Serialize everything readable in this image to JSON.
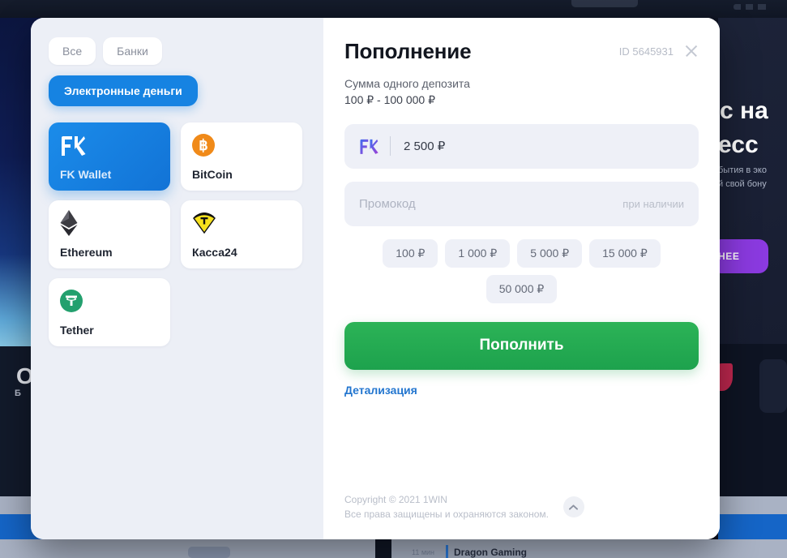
{
  "background": {
    "left_headline": "О",
    "left_subline": "Б",
    "right_headline_line1": "с на",
    "right_headline_line2": "есс",
    "right_sub_line1": "бытия в эко",
    "right_sub_line2": "й свой бону",
    "right_button_label": "НЕЕ",
    "bottom_time": "11 мин",
    "bottom_provider": "Dragon Gaming"
  },
  "left_panel": {
    "filters": [
      {
        "label": "Все",
        "active": false
      },
      {
        "label": "Банки",
        "active": false
      },
      {
        "label": "Электронные деньги",
        "active": true
      }
    ],
    "methods": [
      {
        "label": "FK Wallet",
        "icon": "fk-wallet-icon",
        "selected": true
      },
      {
        "label": "BitCoin",
        "icon": "bitcoin-icon",
        "selected": false
      },
      {
        "label": "Ethereum",
        "icon": "ethereum-icon",
        "selected": false
      },
      {
        "label": "Касса24",
        "icon": "kassa24-icon",
        "selected": false
      },
      {
        "label": "Tether",
        "icon": "tether-icon",
        "selected": false
      }
    ]
  },
  "right_panel": {
    "title": "Пополнение",
    "id_label": "ID 5645931",
    "close_icon": "close-icon",
    "subtitle_line1": "Сумма одного депозита",
    "subtitle_line2": "100 ₽ - 100 000 ₽",
    "amount_field": {
      "icon": "fk-wallet-icon",
      "value": "2 500 ₽"
    },
    "promo_field": {
      "placeholder": "Промокод",
      "hint": "при наличии",
      "value": ""
    },
    "quick_amounts": [
      "100 ₽",
      "1 000 ₽",
      "5 000 ₽",
      "15 000 ₽",
      "50 000 ₽"
    ],
    "submit_label": "Пополнить",
    "detail_link_label": "Детализация",
    "footer": {
      "line1": "Copyright © 2021 1WIN",
      "line2": "Все права защищены и охраняются законом.",
      "scroll_top_icon": "chevron-up-icon"
    }
  },
  "colors": {
    "accent_blue": "#1683e2",
    "accent_green": "#1da24d",
    "link_blue": "#2376cf",
    "panel_bg": "#eceff6",
    "field_bg": "#eef0f7",
    "bitcoin_orange": "#f08a19",
    "tether_green": "#23a06e",
    "kassa24_yellow": "#f7e11e",
    "ethereum_dark": "#2a2a2f"
  }
}
